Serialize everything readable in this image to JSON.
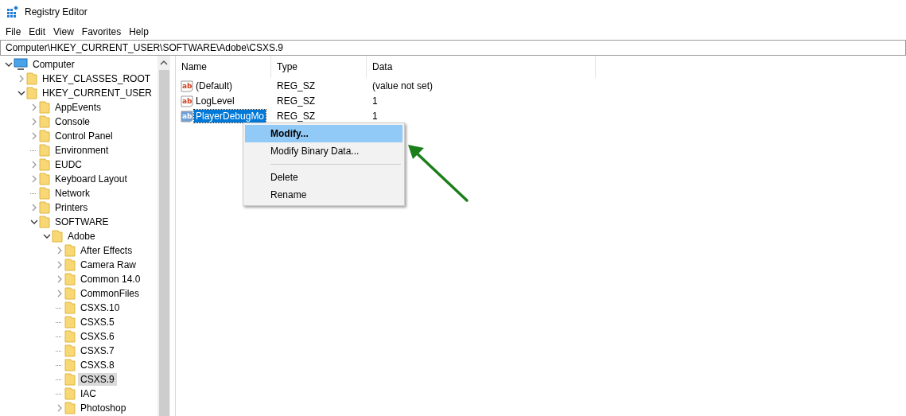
{
  "window": {
    "title": "Registry Editor"
  },
  "menu": [
    "File",
    "Edit",
    "View",
    "Favorites",
    "Help"
  ],
  "address": "Computer\\HKEY_CURRENT_USER\\SOFTWARE\\Adobe\\CSXS.9",
  "tree": [
    {
      "label": "Computer",
      "kind": "computer",
      "expanded": true,
      "selected": false,
      "children": [
        {
          "label": "HKEY_CLASSES_ROOT",
          "kind": "branch",
          "expanded": false,
          "selected": false
        },
        {
          "label": "HKEY_CURRENT_USER",
          "kind": "branch",
          "expanded": true,
          "selected": false,
          "children": [
            {
              "label": "AppEvents",
              "kind": "branch",
              "expanded": false,
              "selected": false
            },
            {
              "label": "Console",
              "kind": "branch",
              "expanded": false,
              "selected": false
            },
            {
              "label": "Control Panel",
              "kind": "branch",
              "expanded": false,
              "selected": false
            },
            {
              "label": "Environment",
              "kind": "leaf",
              "selected": false
            },
            {
              "label": "EUDC",
              "kind": "branch",
              "expanded": false,
              "selected": false
            },
            {
              "label": "Keyboard Layout",
              "kind": "branch",
              "expanded": false,
              "selected": false
            },
            {
              "label": "Network",
              "kind": "leaf",
              "selected": false
            },
            {
              "label": "Printers",
              "kind": "branch",
              "expanded": false,
              "selected": false
            },
            {
              "label": "SOFTWARE",
              "kind": "branch",
              "expanded": true,
              "selected": false,
              "children": [
                {
                  "label": "Adobe",
                  "kind": "branch",
                  "expanded": true,
                  "selected": false,
                  "children": [
                    {
                      "label": "After Effects",
                      "kind": "branch",
                      "expanded": false,
                      "selected": false
                    },
                    {
                      "label": "Camera Raw",
                      "kind": "branch",
                      "expanded": false,
                      "selected": false
                    },
                    {
                      "label": "Common 14.0",
                      "kind": "branch",
                      "expanded": false,
                      "selected": false
                    },
                    {
                      "label": "CommonFiles",
                      "kind": "branch",
                      "expanded": false,
                      "selected": false
                    },
                    {
                      "label": "CSXS.10",
                      "kind": "leaf",
                      "selected": false
                    },
                    {
                      "label": "CSXS.5",
                      "kind": "leaf",
                      "selected": false
                    },
                    {
                      "label": "CSXS.6",
                      "kind": "leaf",
                      "selected": false
                    },
                    {
                      "label": "CSXS.7",
                      "kind": "leaf",
                      "selected": false
                    },
                    {
                      "label": "CSXS.8",
                      "kind": "leaf",
                      "selected": false
                    },
                    {
                      "label": "CSXS.9",
                      "kind": "leaf",
                      "selected": true
                    },
                    {
                      "label": "IAC",
                      "kind": "leaf",
                      "selected": false
                    },
                    {
                      "label": "Photoshop",
                      "kind": "branch",
                      "expanded": false,
                      "selected": false
                    }
                  ]
                }
              ]
            }
          ]
        }
      ]
    }
  ],
  "table": {
    "columns": [
      "Name",
      "Type",
      "Data"
    ],
    "rows": [
      {
        "icon": "ab",
        "name": "(Default)",
        "type": "REG_SZ",
        "data": "(value not set)",
        "selected": false
      },
      {
        "icon": "ab",
        "name": "LogLevel",
        "type": "REG_SZ",
        "data": "1",
        "selected": false
      },
      {
        "icon": "ab",
        "name": "PlayerDebugMo",
        "type": "REG_SZ",
        "data": "1",
        "selected": true
      }
    ]
  },
  "context_menu": [
    {
      "kind": "item",
      "label": "Modify...",
      "selected": true
    },
    {
      "kind": "item",
      "label": "Modify Binary Data...",
      "selected": false
    },
    {
      "kind": "separator"
    },
    {
      "kind": "item",
      "label": "Delete",
      "selected": false
    },
    {
      "kind": "item",
      "label": "Rename",
      "selected": false
    }
  ]
}
